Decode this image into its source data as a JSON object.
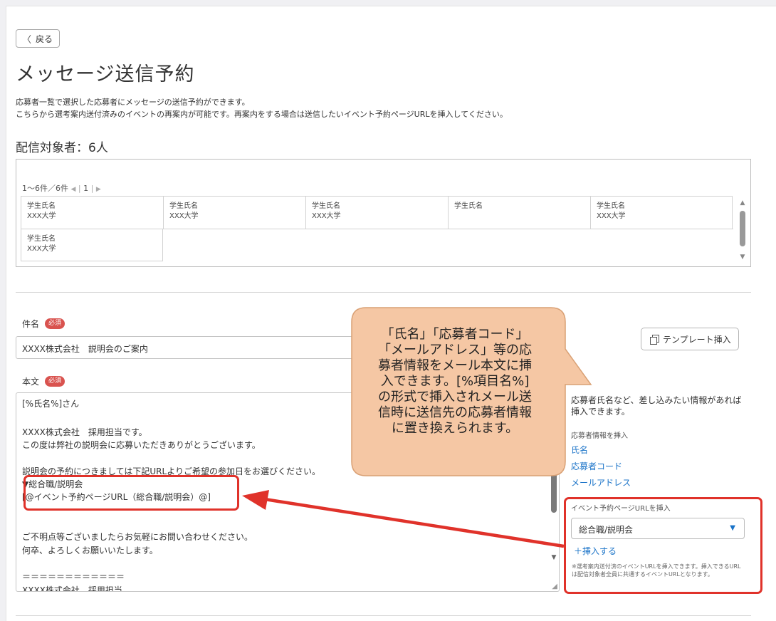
{
  "header": {
    "back_label": "戻る",
    "back_icon": "chevron-left-icon",
    "title": "メッセージ送信予約",
    "description_lines": [
      "応募者一覧で選択した応募者にメッセージの送信予約ができます。",
      "こちらから選考案内送付済みのイベントの再案内が可能です。再案内をする場合は送信したいイベント予約ページURLを挿入してください。"
    ]
  },
  "recipients": {
    "heading": "配信対象者：6人",
    "pager": {
      "range": "1〜6件／6件",
      "page": "1"
    },
    "cells": [
      {
        "name": "学生氏名",
        "school": "XXX大学"
      },
      {
        "name": "学生氏名",
        "school": "XXX大学"
      },
      {
        "name": "学生氏名",
        "school": "XXX大学"
      },
      {
        "name": "学生氏名",
        "school": ""
      },
      {
        "name": "学生氏名",
        "school": "XXX大学"
      },
      {
        "name": "学生氏名",
        "school": "XXX大学"
      }
    ]
  },
  "form": {
    "required_badge": "必須",
    "subject_label": "件名",
    "subject_value": "XXXX株式会社　説明会のご案内",
    "body_label": "本文",
    "body_lines": [
      "[%氏名%]さん",
      "",
      "XXXX株式会社　採用担当です。",
      "この度は弊社の説明会に応募いただきありがとうございます。",
      "",
      "説明会の予約につきましては下記URLよりご希望の参加日をお選びください。",
      "▼総合職/説明会",
      "[@イベント予約ページURL（総合職/説明会）@]",
      "",
      "",
      "ご不明点等ございましたらお気軽にお問い合わせください。",
      "何卒、よろしくお願いいたします。",
      "",
      "＝＝＝＝＝＝＝＝＝＝＝＝",
      "XXXX株式会社　採用担当"
    ]
  },
  "sidebar": {
    "template_button": "テンプレート挿入",
    "template_icon": "copy-icon",
    "help_text": "応募者氏名など、差し込みたい情報があれば挿入できます。",
    "applicant_info_label": "応募者情報を挿入",
    "links": [
      "氏名",
      "応募者コード",
      "メールアドレス"
    ],
    "event_url_label": "イベント予約ページURLを挿入",
    "event_select_value": "総合職/説明会",
    "insert_label": "＋挿入する",
    "note": "※選考案内送付済のイベントURLを挿入できます。挿入できるURLは配信対象者全員に共通するイベントURLとなります。"
  },
  "callout": {
    "lines": [
      "「氏名」「応募者コード」",
      "「メールアドレス」等の応",
      "募者情報をメール本文に挿",
      "入できます。[%項目名%]",
      "の形式で挿入されメール送",
      "信時に送信先の応募者情報",
      "に置き換えられます。"
    ],
    "fill_color": "#f5c7a4",
    "border_color": "#d9a074",
    "highlight_color": "#e0322a"
  }
}
